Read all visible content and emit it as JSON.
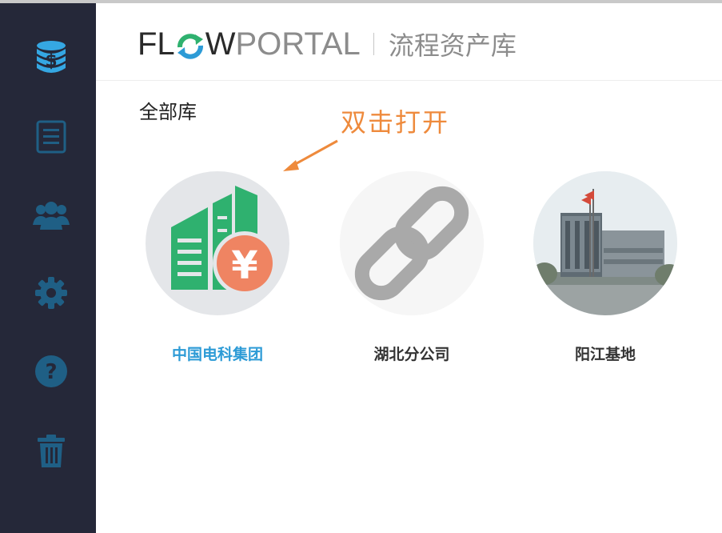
{
  "header": {
    "logo_flow": "FL",
    "logo_w": "W",
    "logo_portal": "PORTAL",
    "subtitle": "流程资产库"
  },
  "sidebar": {
    "items": [
      {
        "icon": "database-dollar-icon"
      },
      {
        "icon": "document-list-icon"
      },
      {
        "icon": "users-group-icon"
      },
      {
        "icon": "gear-icon"
      },
      {
        "icon": "help-icon"
      },
      {
        "icon": "trash-icon"
      }
    ]
  },
  "main": {
    "section_title": "全部库",
    "hint": "双击打开",
    "libraries": [
      {
        "label": "中国电科集团",
        "icon": "building-yuan-icon",
        "selected": true
      },
      {
        "label": "湖北分公司",
        "icon": "chain-link-icon",
        "selected": false
      },
      {
        "label": "阳江基地",
        "icon": "factory-photo-icon",
        "selected": false
      }
    ]
  },
  "colors": {
    "sidebar_bg": "#252839",
    "sidebar_icon": "#2d9bd6",
    "selected_label": "#2d9bd6",
    "hint": "#ee8a3c",
    "building_green": "#2fb16f",
    "yuan_orange": "#ef8462"
  }
}
